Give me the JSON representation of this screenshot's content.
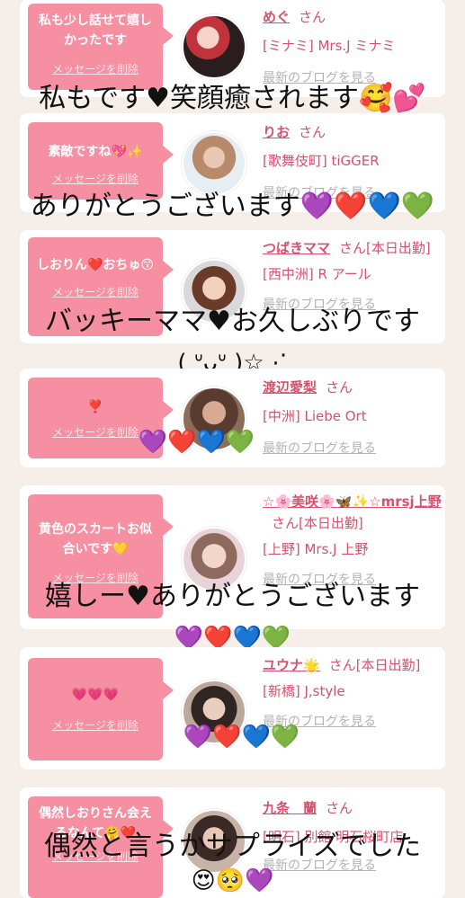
{
  "messages": [
    {
      "bubble": "私も少し話せて嬉しかったです",
      "delete": "メッセージを削除",
      "name": "めぐ",
      "san": "さん",
      "shop": "[ミナミ] Mrs.J ミナミ",
      "blog": "最新のブログを見る",
      "reply": "私もです♥笑顔癒されます🥰💕"
    },
    {
      "bubble": "素敵ですね💖✨",
      "delete": "メッセージを削除",
      "name": "りお",
      "san": "さん",
      "shop": "[歌舞伎町] tiGGER",
      "blog": "最新のブログを見る",
      "reply": "ありがとうございます💜❤️💙💚"
    },
    {
      "bubble": "しおりん❤️おちゅ😙",
      "delete": "メッセージを削除",
      "name": "つばきママ",
      "san": "さん[本日出勤]",
      "shop": "[西中洲] R アール",
      "blog": "最新のブログを見る",
      "reply": "バッキーママ♥お久しぶりです",
      "reply2": "( ᐡᴗᐡ )☆⋰"
    },
    {
      "bubble": "❣️",
      "delete": "メッセージを削除",
      "name": "渡辺愛梨",
      "san": "さん",
      "shop": "[中洲] Liebe Ort",
      "blog": "最新のブログを見る",
      "reply": "💜❤️💙💚"
    },
    {
      "bubble": "黄色のスカートお似合いです💛",
      "delete": "メッセージを削除",
      "name": "☆🌸美咲🌸🦋✨☆mrsj上野",
      "san": "さん[本日出勤]",
      "shop": "[上野] Mrs.J 上野",
      "blog": "最新のブログを見る",
      "reply": "嬉しー♥ありがとうございます",
      "reply2": "💜❤️💙💚"
    },
    {
      "bubble": "💗💗💗",
      "delete": "メッセージを削除",
      "name": "ユウナ🌟",
      "san": "さん[本日出勤]",
      "shop": "[新橋] J,style",
      "blog": "最新のブログを見る",
      "reply": "💜❤️💙💚"
    },
    {
      "bubble": "偶然しおりさん会えるなんて🤗❤️",
      "delete": "メッセージを削除",
      "name": "九条　蘭",
      "san": "さん",
      "shop": "[明石] 別館 明石桜町店",
      "blog": "最新のブログを見る",
      "reply": "偶然と言うかサプライズでした",
      "reply2": "😍🥺💜"
    }
  ],
  "colors": {
    "accent": "#d7506c",
    "bubble": "#f58fa1",
    "background": "#f6efe9"
  }
}
